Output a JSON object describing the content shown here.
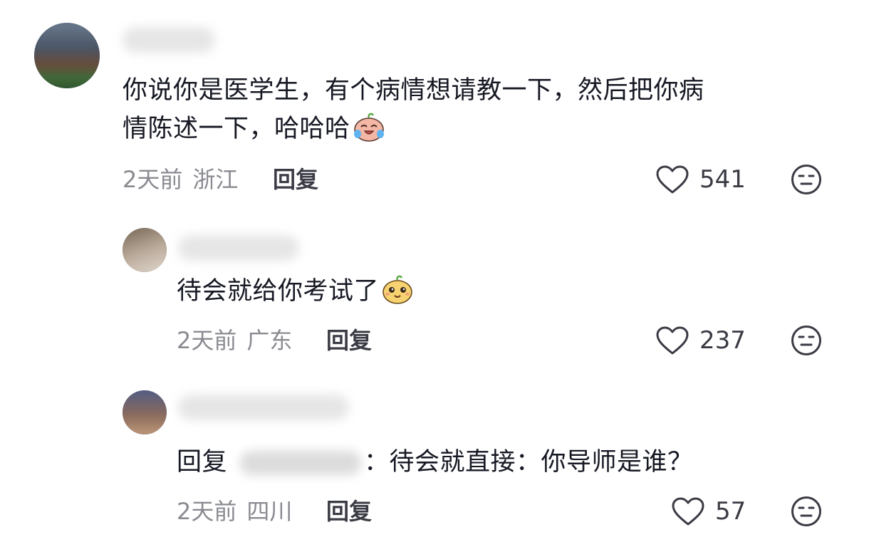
{
  "comments": [
    {
      "text_line1": "你说你是医学生，有个病情想请教一下，然后把你病",
      "text_line2": "情陈述一下，哈哈哈",
      "emoji": "crying-laughing-emoji",
      "time": "2天前",
      "location": "浙江",
      "reply_label": "回复",
      "likes": "541"
    },
    {
      "text": "待会就给你考试了",
      "emoji": "smiling-emoji",
      "time": "2天前",
      "location": "广东",
      "reply_label": "回复",
      "likes": "237"
    },
    {
      "reply_prefix": "回复",
      "name_suffix": "：",
      "text": "待会就直接：你导师是谁？",
      "time": "2天前",
      "location": "四川",
      "reply_label": "回复",
      "likes": "57"
    }
  ],
  "icons": {
    "like": "heart-outline-icon",
    "dislike": "meh-face-icon"
  },
  "colors": {
    "text": "#161823",
    "meta": "#8a8b91",
    "icon": "#3a3b44"
  }
}
